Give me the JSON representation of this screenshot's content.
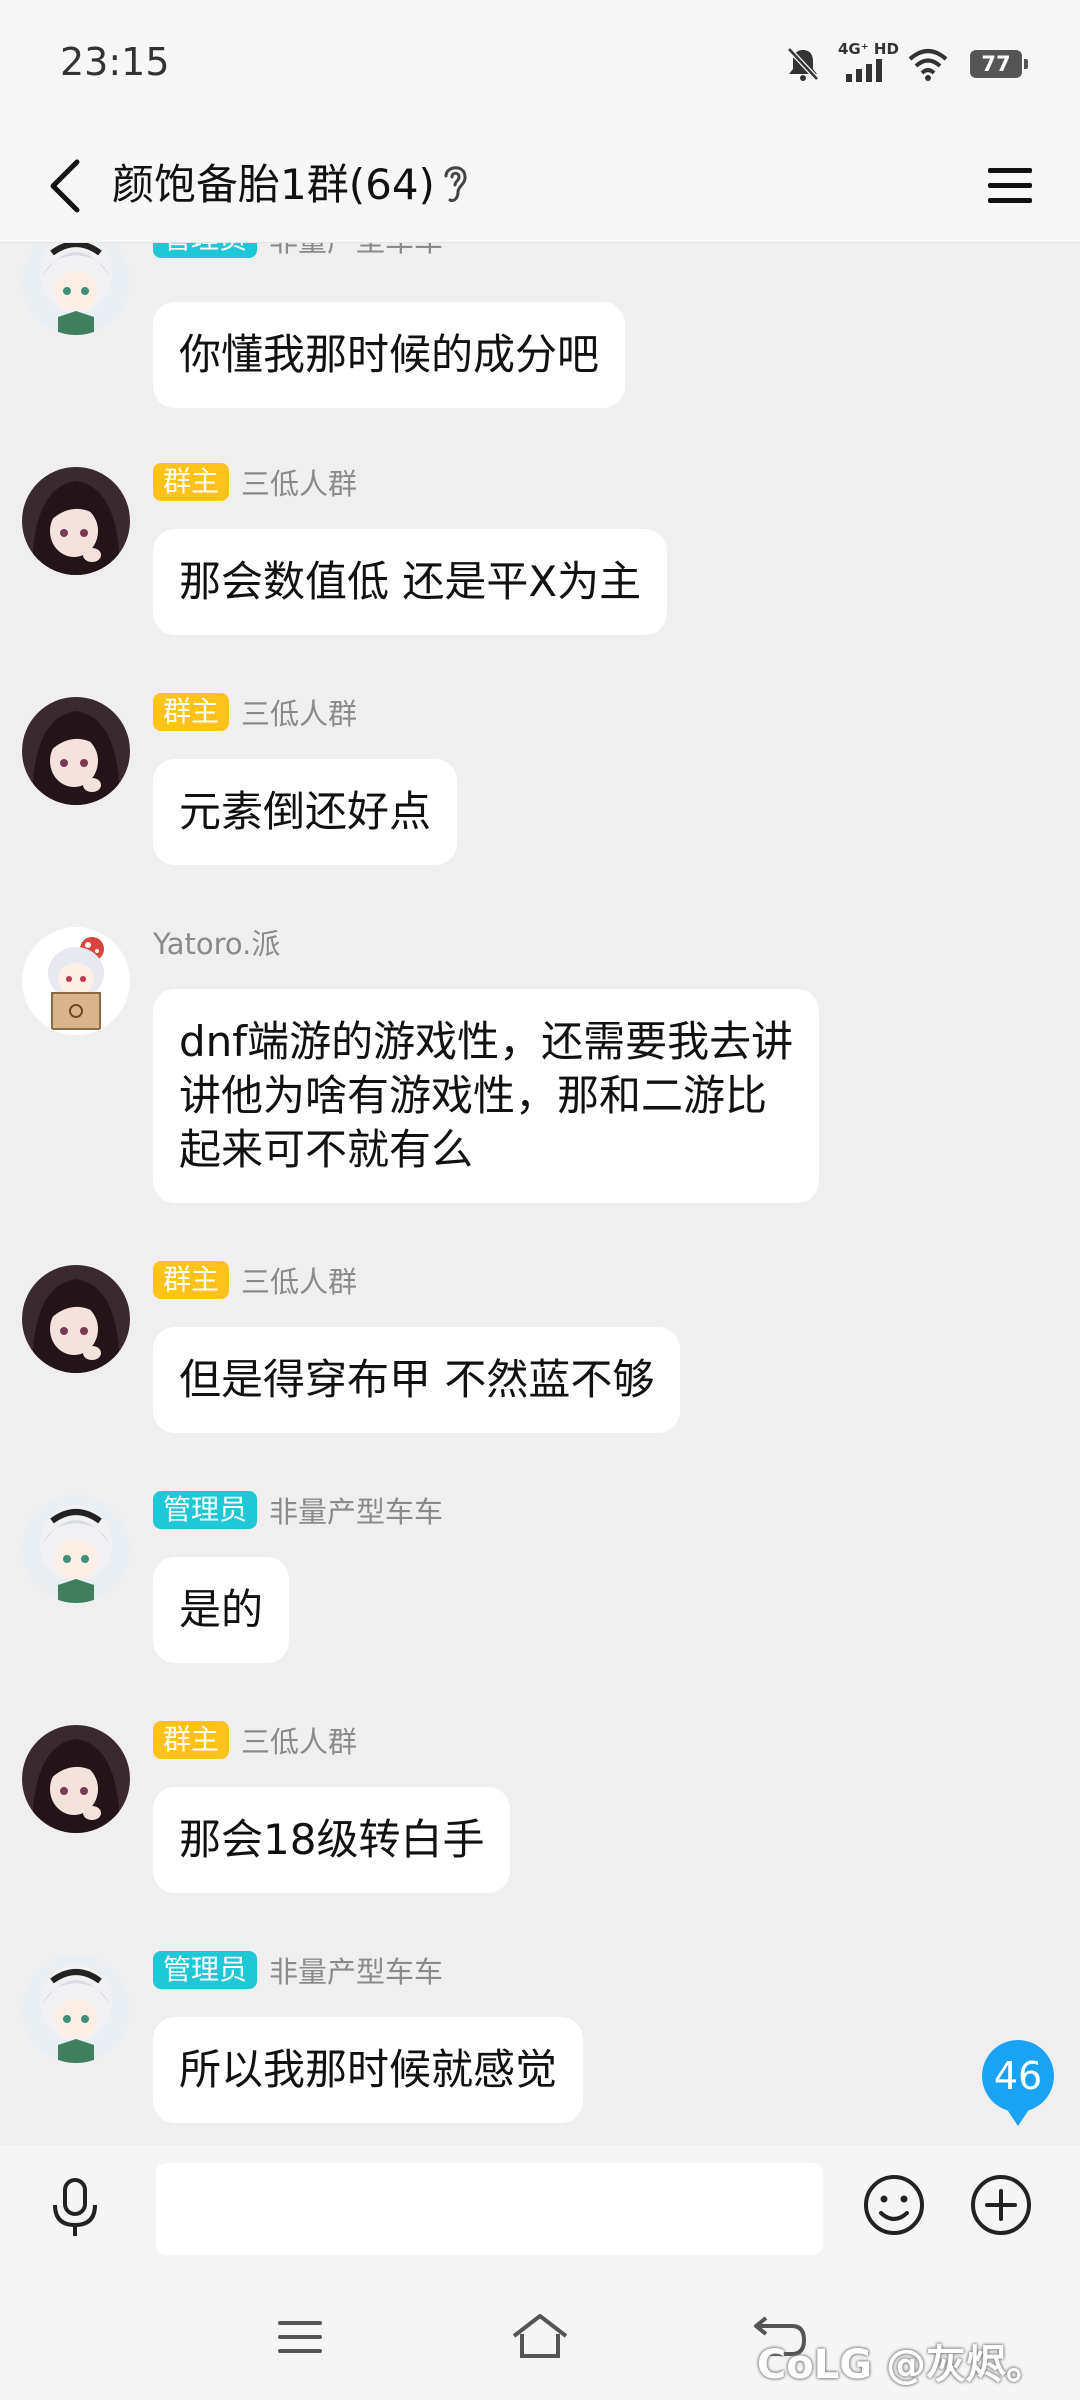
{
  "status_bar": {
    "time": "23:15",
    "network": "4G⁺ HD",
    "battery": "77"
  },
  "header": {
    "title": "颜饱备胎1群(64)"
  },
  "badges": {
    "admin": "管理员",
    "owner": "群主"
  },
  "messages": [
    {
      "role": "管理员",
      "sender": "非量产型车车",
      "text": "你懂我那时候的成分吧"
    },
    {
      "role": "群主",
      "sender": "三低人群",
      "text": "那会数值低 还是平X为主"
    },
    {
      "role": "群主",
      "sender": "三低人群",
      "text": "元素倒还好点"
    },
    {
      "role": "",
      "sender": "Yatoro.派",
      "text": "dnf端游的游戏性，还需要我去讲\n讲他为啥有游戏性，那和二游比\n起来可不就有么"
    },
    {
      "role": "群主",
      "sender": "三低人群",
      "text": "但是得穿布甲 不然蓝不够"
    },
    {
      "role": "管理员",
      "sender": "非量产型车车",
      "text": "是的"
    },
    {
      "role": "群主",
      "sender": "三低人群",
      "text": "那会18级转白手"
    },
    {
      "role": "管理员",
      "sender": "非量产型车车",
      "text": "所以我那时候就感觉"
    }
  ],
  "unread_count": "46",
  "input": {
    "placeholder": ""
  },
  "watermark": "CoLG @灰烬。",
  "colors": {
    "admin_badge": "#1fc8d6",
    "owner_badge": "#ffc21a",
    "unread": "#1aa3f5",
    "background": "#efefef"
  },
  "icons": [
    "back-arrow-icon",
    "ear-icon",
    "menu-icon",
    "mic-icon",
    "emoji-icon",
    "plus-icon",
    "hamburger-nav-icon",
    "home-icon",
    "back-nav-icon"
  ]
}
